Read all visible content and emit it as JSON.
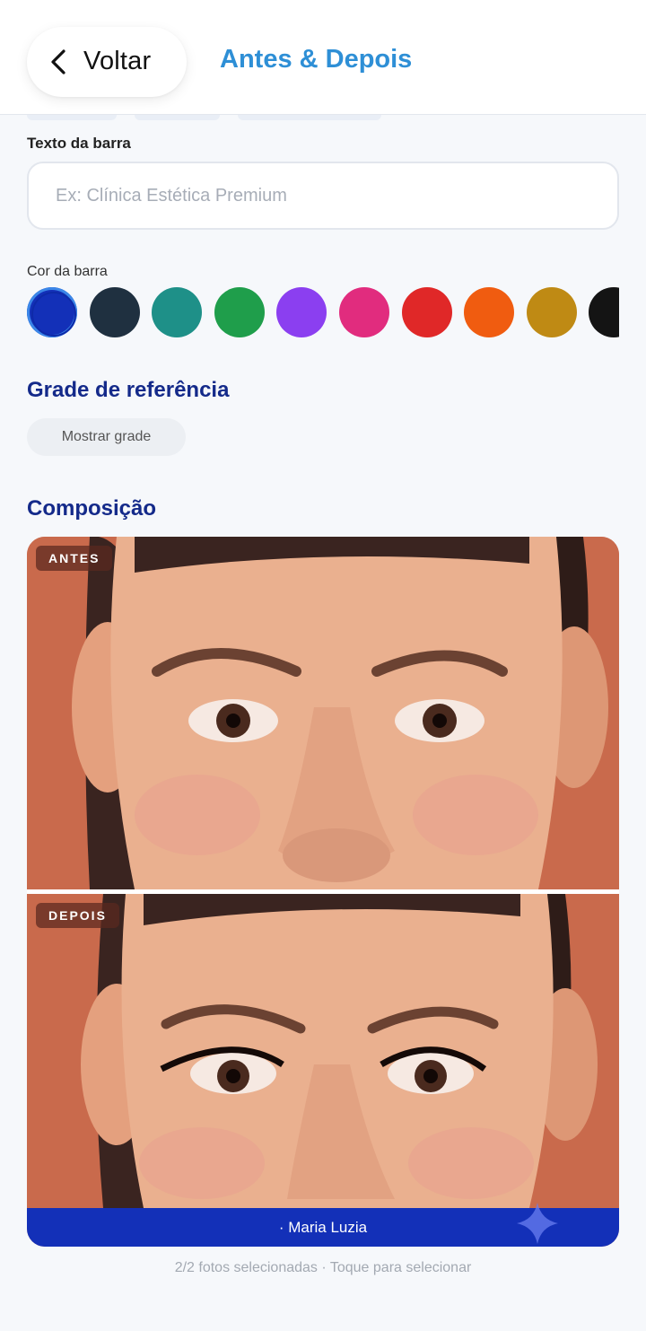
{
  "header": {
    "back_label": "Voltar",
    "title": "Antes & Depois"
  },
  "bar_text": {
    "label": "Texto da barra",
    "placeholder": "Ex: Clínica Estética Premium",
    "value": ""
  },
  "bar_color": {
    "label": "Cor da barra",
    "selected_index": 0,
    "options": [
      "#1330b8",
      "#1f3040",
      "#1e9088",
      "#1f9e4b",
      "#8b3ff0",
      "#e12c7e",
      "#e02828",
      "#f05c10",
      "#bf8a14",
      "#141414"
    ]
  },
  "grid": {
    "title": "Grade de referência",
    "button_label": "Mostrar grade"
  },
  "composition": {
    "title": "Composição",
    "before_tag": "ANTES",
    "after_tag": "DEPOIS",
    "bar_caption": "· Maria Luzia",
    "bar_color": "#1330b8",
    "background_color": "#c86a4e"
  },
  "footer": {
    "note": "2/2 fotos selecionadas · Toque para selecionar"
  }
}
